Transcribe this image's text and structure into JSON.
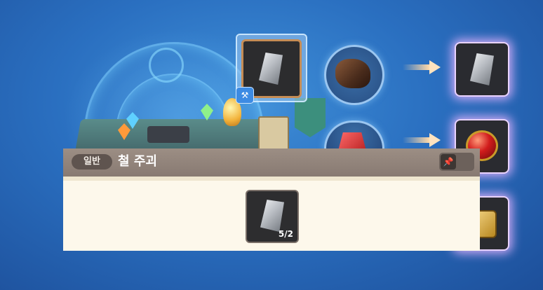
{
  "background": {
    "theme_color": "#2a6fc0"
  },
  "recipe": {
    "selected_slot": {
      "icon": "iron-ingot-icon",
      "badge_icon": "anvil-badge-icon"
    },
    "ingredient_slots": [
      {
        "icon": "ore-chunk-icon"
      },
      {
        "icon": "red-gem-icon"
      }
    ],
    "result_slots": [
      {
        "icon": "iron-ingot-icon"
      },
      {
        "icon": "red-gem-icon"
      },
      {
        "icon": "dice-gem-icon"
      }
    ],
    "arrow_icon": "arrow-right-icon"
  },
  "item_panel": {
    "grade": "일반",
    "title": "철 주괴",
    "pin_icon": "pin-icon",
    "material": {
      "icon": "iron-ingot-icon",
      "count": "5/2"
    }
  }
}
